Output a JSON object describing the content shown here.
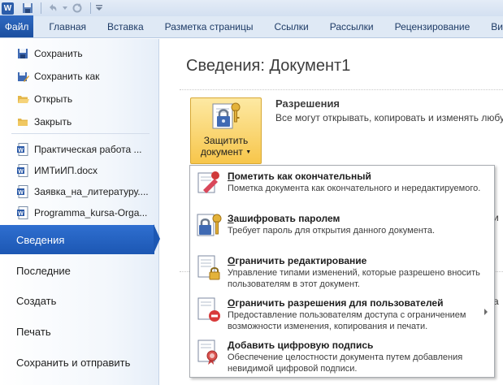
{
  "app_icon_letter": "W",
  "ribbon": {
    "file_tab": "Файл",
    "tabs": [
      "Главная",
      "Вставка",
      "Разметка страницы",
      "Ссылки",
      "Рассылки",
      "Рецензирование",
      "Ви"
    ]
  },
  "backstage": {
    "commands": [
      {
        "label": "Сохранить",
        "icon": "save-icon"
      },
      {
        "label": "Сохранить как",
        "icon": "save-as-icon"
      },
      {
        "label": "Открыть",
        "icon": "open-folder-icon"
      },
      {
        "label": "Закрыть",
        "icon": "close-folder-icon"
      }
    ],
    "recent_docs": [
      "Практическая работа ...",
      "ИМТиИП.docx",
      "Заявка_на_литературу....",
      "Programma_kursa-Orga..."
    ],
    "sections": [
      "Сведения",
      "Последние",
      "Создать",
      "Печать",
      "Сохранить и отправить"
    ],
    "selected_section": "Сведения"
  },
  "main": {
    "title": "Сведения: Документ1",
    "protect_button": {
      "line1": "Защитить",
      "line2": "документ"
    },
    "permissions": {
      "title": "Разрешения",
      "description": "Все могут открывать, копировать и изменять любу"
    },
    "partial_letters": [
      "и",
      "а"
    ]
  },
  "protect_menu": [
    {
      "title": "Пометить как окончательный",
      "underline": "П",
      "rest": "ометить как окончательный",
      "desc": "Пометка документа как окончательного и нередактируемого.",
      "icon": "mark-final-icon"
    },
    {
      "title": "Зашифровать паролем",
      "underline": "З",
      "rest": "ашифровать паролем",
      "desc": "Требует пароль для открытия данного документа.",
      "icon": "encrypt-lock-icon"
    },
    {
      "title": "Ограничить редактирование",
      "underline": "О",
      "rest": "граничить редактирование",
      "desc": "Управление типами изменений, которые разрешено вносить пользователям в этот документ.",
      "icon": "restrict-editing-icon"
    },
    {
      "title": "Ограничить разрешения для пользователей",
      "underline": "О",
      "rest": "граничить разрешения для пользователей",
      "desc": "Предоставление пользователям доступа с ограничением возможности изменения, копирования и печати.",
      "icon": "restrict-permission-icon"
    },
    {
      "title": "Добавить цифровую подпись",
      "underline": "Д",
      "rest": "обавить цифровую подпись",
      "desc": "Обеспечение целостности документа путем добавления невидимой цифровой подписи.",
      "icon": "digital-signature-icon"
    }
  ]
}
